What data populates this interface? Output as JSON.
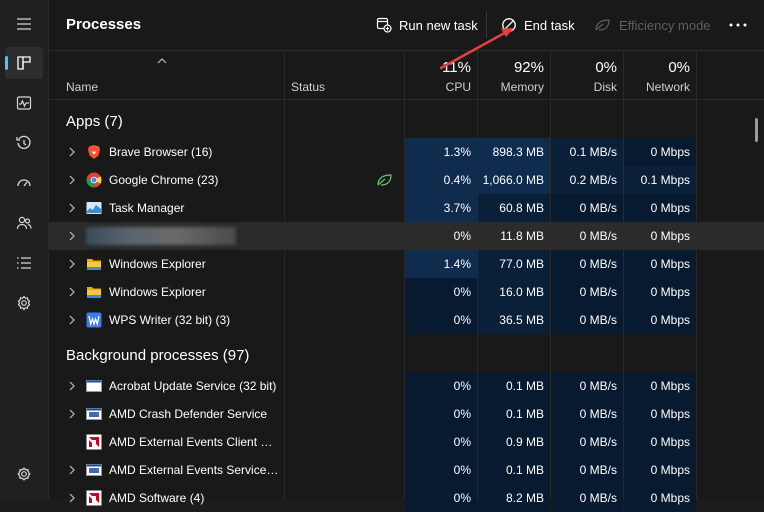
{
  "sidebar": {
    "items": [
      {
        "icon": "hamburger-menu-icon"
      },
      {
        "icon": "processes-icon",
        "active": true
      },
      {
        "icon": "performance-icon"
      },
      {
        "icon": "app-history-icon"
      },
      {
        "icon": "startup-apps-icon"
      },
      {
        "icon": "users-icon"
      },
      {
        "icon": "details-icon"
      },
      {
        "icon": "services-icon"
      },
      {
        "icon": "settings-icon"
      }
    ]
  },
  "toolbar": {
    "title": "Processes",
    "run_new_task": "Run new task",
    "end_task": "End task",
    "efficiency_mode": "Efficiency mode"
  },
  "columns": {
    "name": "Name",
    "status": "Status",
    "cpu_label": "CPU",
    "cpu_pct": "11%",
    "memory_label": "Memory",
    "memory_pct": "92%",
    "disk_label": "Disk",
    "disk_pct": "0%",
    "network_label": "Network",
    "network_pct": "0%"
  },
  "groups": {
    "apps": "Apps (7)",
    "background": "Background processes (97)"
  },
  "apps": [
    {
      "name": "Brave Browser (16)",
      "icon": "brave-icon",
      "cpu": "1.3%",
      "mem": "898.3 MB",
      "disk": "0.1 MB/s",
      "net": "0 Mbps",
      "efficiency_icon": false
    },
    {
      "name": "Google Chrome (23)",
      "icon": "chrome-icon",
      "cpu": "0.4%",
      "mem": "1,066.0 MB",
      "disk": "0.2 MB/s",
      "net": "0.1 Mbps",
      "efficiency_icon": true
    },
    {
      "name": "Task Manager",
      "icon": "task-manager-icon",
      "cpu": "3.7%",
      "mem": "60.8 MB",
      "disk": "0 MB/s",
      "net": "0 Mbps",
      "efficiency_icon": false
    },
    {
      "name": "",
      "icon": "redacted",
      "cpu": "0%",
      "mem": "11.8 MB",
      "disk": "0 MB/s",
      "net": "0 Mbps",
      "efficiency_icon": false
    },
    {
      "name": "Windows Explorer",
      "icon": "folder-icon",
      "cpu": "1.4%",
      "mem": "77.0 MB",
      "disk": "0 MB/s",
      "net": "0 Mbps",
      "efficiency_icon": false
    },
    {
      "name": "Windows Explorer",
      "icon": "folder-icon",
      "cpu": "0%",
      "mem": "16.0 MB",
      "disk": "0 MB/s",
      "net": "0 Mbps",
      "efficiency_icon": false
    },
    {
      "name": "WPS Writer (32 bit) (3)",
      "icon": "wps-writer-icon",
      "cpu": "0%",
      "mem": "36.5 MB",
      "disk": "0 MB/s",
      "net": "0 Mbps",
      "efficiency_icon": false
    }
  ],
  "background": [
    {
      "name": "Acrobat Update Service (32 bit)",
      "icon": "service-window-icon",
      "cpu": "0%",
      "mem": "0.1 MB",
      "disk": "0 MB/s",
      "net": "0 Mbps",
      "expandable": true
    },
    {
      "name": "AMD Crash Defender Service",
      "icon": "service-window-icon",
      "cpu": "0%",
      "mem": "0.1 MB",
      "disk": "0 MB/s",
      "net": "0 Mbps",
      "expandable": true
    },
    {
      "name": "AMD External Events Client Module",
      "icon": "amd-icon",
      "cpu": "0%",
      "mem": "0.9 MB",
      "disk": "0 MB/s",
      "net": "0 Mbps",
      "expandable": false
    },
    {
      "name": "AMD External Events Service Module",
      "icon": "service-window-icon",
      "cpu": "0%",
      "mem": "0.1 MB",
      "disk": "0 MB/s",
      "net": "0 Mbps",
      "expandable": true
    },
    {
      "name": "AMD Software (4)",
      "icon": "amd-icon",
      "cpu": "0%",
      "mem": "8.2 MB",
      "disk": "0 MB/s",
      "net": "0 Mbps",
      "expandable": true
    }
  ]
}
